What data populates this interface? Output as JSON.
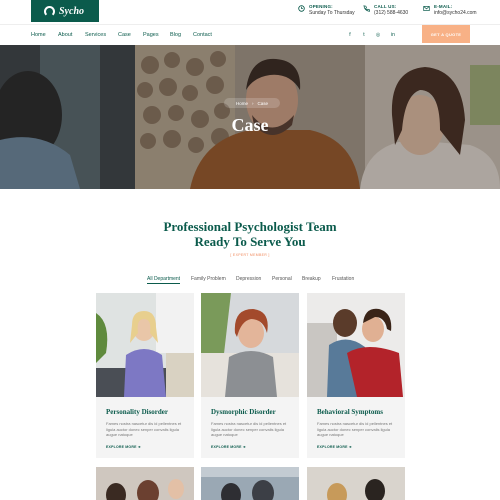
{
  "brand": {
    "name": "Sycho"
  },
  "header_info": [
    {
      "icon": "clock-icon",
      "label": "OPENING:",
      "value": "Sunday To Thursday"
    },
    {
      "icon": "phone-icon",
      "label": "CALL US:",
      "value": "(312) 588-4630"
    },
    {
      "icon": "mail-icon",
      "label": "E-MAIL:",
      "value": "info@sycho24.com"
    }
  ],
  "nav": {
    "items": [
      "Home",
      "About",
      "Services",
      "Case",
      "Pages",
      "Blog",
      "Contact"
    ],
    "social": [
      {
        "icon": "facebook-icon",
        "glyph": "f"
      },
      {
        "icon": "twitter-icon",
        "glyph": "t"
      },
      {
        "icon": "instagram-icon",
        "glyph": "◎"
      },
      {
        "icon": "linkedin-icon",
        "glyph": "in"
      }
    ],
    "cta": "GET A QUOTE"
  },
  "hero": {
    "breadcrumb": [
      "Home",
      "Case"
    ],
    "title": "Case"
  },
  "section": {
    "title_line1": "Professional Psychologist Team",
    "title_line2": "Ready To Serve You",
    "tag": "[ EXPERT MEMBER ]"
  },
  "filters": [
    "All Department",
    "Family Problem",
    "Depression",
    "Personal",
    "Breakup",
    "Frustation"
  ],
  "cards": [
    {
      "title": "Personality Disorder",
      "desc": "Fames nostra nascetur dis id pellentnes et ligula auctor donec senper convalis ligula augue natoque",
      "link": "EXPLORE MORE  ➜"
    },
    {
      "title": "Dysmorphic Disorder",
      "desc": "Fames nostra nascetur dis id pellentnes et ligula auctor donec senper convalis ligula augue natoque",
      "link": "EXPLORE MORE  ➜"
    },
    {
      "title": "Behavioral Symptoms",
      "desc": "Fames nostra nascetur dis id pellentnes et ligula auctor donec senper convalis ligula augue natoque",
      "link": "EXPLORE MORE  ➜"
    }
  ],
  "colors": {
    "primary": "#0b5b4c",
    "accent": "#f8b186",
    "tag": "#f08a5d"
  }
}
